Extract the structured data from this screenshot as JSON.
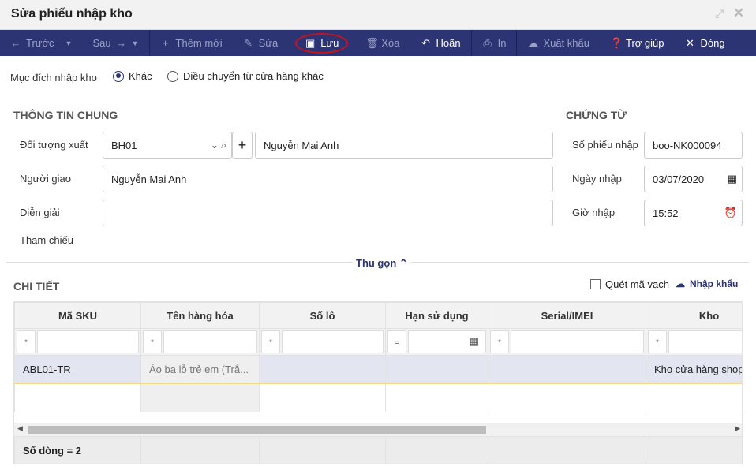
{
  "window": {
    "title": "Sửa phiếu nhập kho"
  },
  "toolbar": {
    "prev": "Trước",
    "next": "Sau",
    "add": "Thêm mới",
    "edit": "Sửa",
    "save": "Lưu",
    "delete": "Xóa",
    "undo": "Hoãn",
    "print": "In",
    "export": "Xuất khẩu",
    "help": "Trợ giúp",
    "close": "Đóng"
  },
  "purpose": {
    "label": "Mục đích nhập kho",
    "options": [
      "Khác",
      "Điều chuyển từ cửa hàng khác"
    ],
    "selected": "Khác"
  },
  "general": {
    "title": "THÔNG TIN CHUNG",
    "export_target_label": "Đối tượng xuất",
    "export_target_code": "BH01",
    "export_target_name": "Nguyễn Mai Anh",
    "deliverer_label": "Người giao",
    "deliverer": "Nguyễn Mai Anh",
    "description_label": "Diễn giải",
    "description": "",
    "reference_label": "Tham chiếu"
  },
  "voucher": {
    "title": "CHỨNG TỪ",
    "number_label": "Số phiếu nhập",
    "number": "boo-NK000094",
    "date_label": "Ngày nhập",
    "date": "03/07/2020",
    "time_label": "Giờ nhập",
    "time": "15:52"
  },
  "collapse": "Thu gọn",
  "detail": {
    "title": "CHI TIẾT",
    "scan_label": "Quét mã vạch",
    "import_label": "Nhập khẩu",
    "columns": [
      "Mã SKU",
      "Tên hàng hóa",
      "Số lô",
      "Hạn sử dụng",
      "Serial/IMEI",
      "Kho"
    ],
    "filter_ops": [
      "*",
      "*",
      "*",
      "=",
      "*",
      "*"
    ],
    "rows": [
      [
        "ABL01-TR",
        "Áo ba lỗ trẻ em (Trắ...",
        "",
        "",
        "",
        "Kho cửa hàng shop"
      ]
    ],
    "footer": "Số dòng = 2"
  }
}
